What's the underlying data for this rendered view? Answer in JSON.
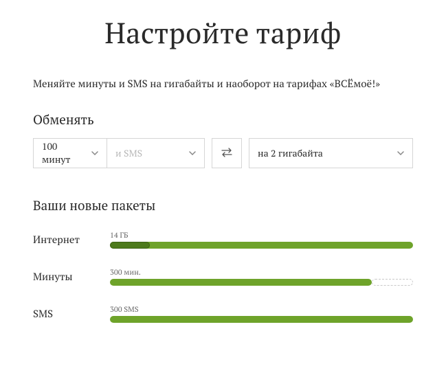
{
  "title": "Настройте тариф",
  "subtitle": "Меняйте минуты и SMS на гигабайты и наоборот на тарифах «ВСЁмоё!»",
  "exchange": {
    "label": "Обменять",
    "minutes_value": "100 минут",
    "sms_placeholder": "и SMS",
    "gb_value": "на 2 гигабайта"
  },
  "packages": {
    "title": "Ваши новые пакеты",
    "internet": {
      "label": "Интернет",
      "value": "14 ГБ"
    },
    "minutes": {
      "label": "Минуты",
      "value": "300 мин."
    },
    "sms": {
      "label": "SMS",
      "value": "300 SMS"
    }
  }
}
